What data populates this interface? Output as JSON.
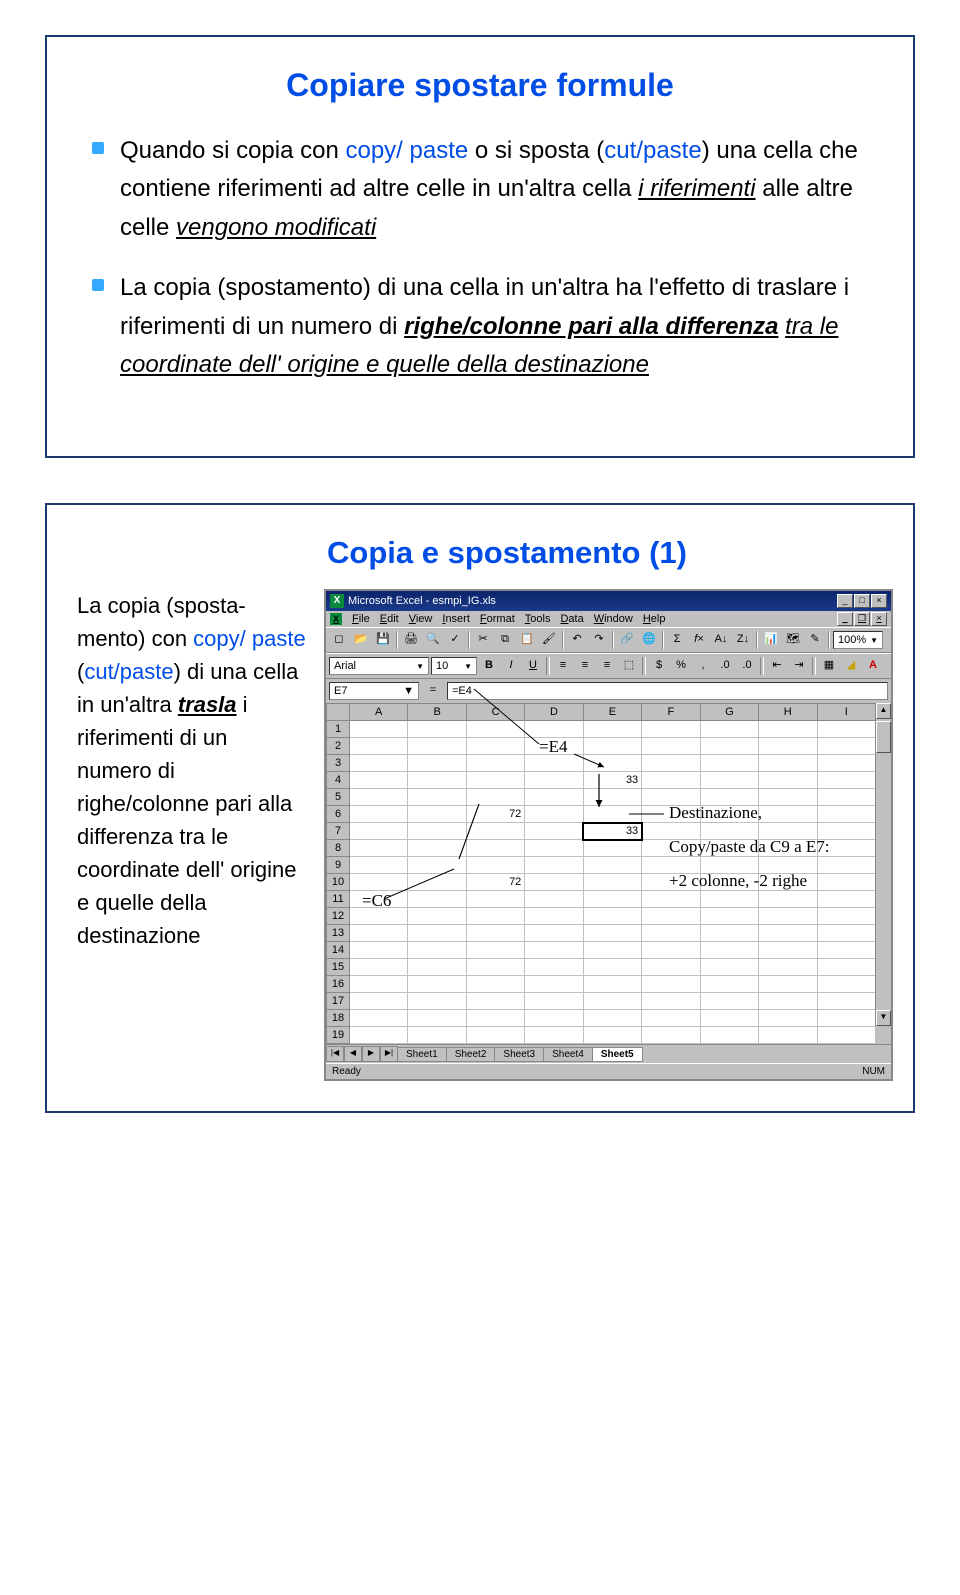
{
  "slide1": {
    "title": "Copiare spostare formule",
    "b1_p1": "Quando si copia con ",
    "b1_copy": "copy/ paste",
    "b1_p2": " o si sposta (",
    "b1_cut": "cut/paste",
    "b1_p3": ") una cella che contiene riferimenti ad altre celle in un'altra cella ",
    "b1_ref1": "i riferimenti",
    "b1_p4": " alle altre celle ",
    "b1_ref2": "vengono modificati",
    "b2_p1": "La copia (spostamento) di una cella in un'altra ha l'effetto di traslare i riferimenti di un numero di ",
    "b2_em1": "righe/colonne pari alla differenza",
    "b2_p2": " ",
    "b2_em2": "tra le coordinate dell' origine e quelle della destinazione"
  },
  "slide2": {
    "title": "Copia e spostamento (1)",
    "left_p1": "La copia (sposta-mento) con ",
    "left_copy": "copy/ paste",
    "left_p2": " (",
    "left_cut": "cut/paste",
    "left_p3": ") di una cella in un'altra ",
    "left_trasla": "trasla",
    "left_p4": " i riferimenti di un numero di righe/colonne pari alla differenza tra le coordinate dell' origine e quelle della destinazione"
  },
  "excel": {
    "title": "Microsoft Excel - esmpi_IG.xls",
    "menu": [
      "File",
      "Edit",
      "View",
      "Insert",
      "Format",
      "Tools",
      "Data",
      "Window",
      "Help"
    ],
    "font": "Arial",
    "fontsize": "10",
    "zoom": "100%",
    "namebox": "E7",
    "formula": "=E4",
    "cols": [
      "A",
      "B",
      "C",
      "D",
      "E",
      "F",
      "G",
      "H",
      "I"
    ],
    "rows": [
      "1",
      "2",
      "3",
      "4",
      "5",
      "6",
      "7",
      "8",
      "9",
      "10",
      "11",
      "12",
      "13",
      "14",
      "15",
      "16",
      "17",
      "18",
      "19"
    ],
    "e4": "33",
    "c6": "72",
    "e7": "33",
    "c10": "72",
    "sheets": [
      "Sheet1",
      "Sheet2",
      "Sheet3",
      "Sheet4",
      "Sheet5"
    ],
    "active_sheet": "Sheet5",
    "status_left": "Ready",
    "status_right": "NUM"
  },
  "annot": {
    "e4": "=E4",
    "c6": "=C6",
    "dest": "Destinazione,",
    "cp": "Copy/paste da C9 a E7:",
    "delta": "+2 colonne, -2 righe"
  }
}
